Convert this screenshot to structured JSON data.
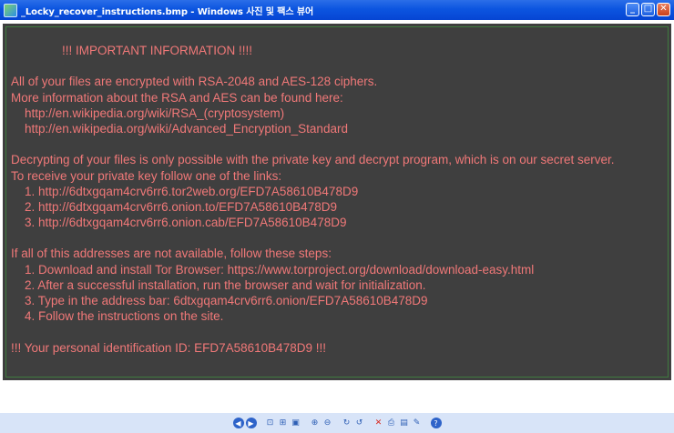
{
  "window": {
    "title": "_Locky_recover_instructions.bmp - Windows 사진 및 팩스 뷰어",
    "minimize_label": "_",
    "maximize_label": "□",
    "close_label": "✕"
  },
  "image": {
    "heading": "!!! IMPORTANT INFORMATION !!!!",
    "lines": [
      "",
      "All of your files are encrypted with RSA-2048 and AES-128 ciphers.",
      "More information about the RSA and AES can be found here:",
      "    http://en.wikipedia.org/wiki/RSA_(cryptosystem)",
      "    http://en.wikipedia.org/wiki/Advanced_Encryption_Standard",
      "",
      "Decrypting of your files is only possible with the private key and decrypt program, which is on our secret server.",
      "To receive your private key follow one of the links:",
      "    1. http://6dtxgqam4crv6rr6.tor2web.org/EFD7A58610B478D9",
      "    2. http://6dtxgqam4crv6rr6.onion.to/EFD7A58610B478D9",
      "    3. http://6dtxgqam4crv6rr6.onion.cab/EFD7A58610B478D9",
      "",
      "If all of this addresses are not available, follow these steps:",
      "    1. Download and install Tor Browser: https://www.torproject.org/download/download-easy.html",
      "    2. After a successful installation, run the browser and wait for initialization.",
      "    3. Type in the address bar: 6dtxgqam4crv6rr6.onion/EFD7A58610B478D9",
      "    4. Follow the instructions on the site.",
      "",
      "!!! Your personal identification ID: EFD7A58610B478D9 !!!"
    ]
  },
  "toolbar": {
    "buttons": [
      {
        "name": "previous-image-icon",
        "glyph": "◀",
        "style": "circle"
      },
      {
        "name": "next-image-icon",
        "glyph": "▶",
        "style": "circle"
      },
      {
        "name": "best-fit-icon",
        "glyph": "⊡"
      },
      {
        "name": "actual-size-icon",
        "glyph": "⊞"
      },
      {
        "name": "slideshow-icon",
        "glyph": "▣"
      },
      {
        "name": "zoom-in-icon",
        "glyph": "⊕"
      },
      {
        "name": "zoom-out-icon",
        "glyph": "⊖"
      },
      {
        "name": "rotate-clockwise-icon",
        "glyph": "↻"
      },
      {
        "name": "rotate-counterclockwise-icon",
        "glyph": "↺"
      },
      {
        "name": "delete-icon",
        "glyph": "✕"
      },
      {
        "name": "print-icon",
        "glyph": "⎙"
      },
      {
        "name": "copy-to-icon",
        "glyph": "▤"
      },
      {
        "name": "open-for-editing-icon",
        "glyph": "✎"
      },
      {
        "name": "help-icon",
        "glyph": "?",
        "style": "circle"
      }
    ],
    "colors": {
      "delete": "#d8261c",
      "help": "#2e63c9"
    }
  },
  "colors": {
    "message_text": "#f07878",
    "image_background": "#3f3f3f",
    "title_bar": "#0c55e0"
  }
}
